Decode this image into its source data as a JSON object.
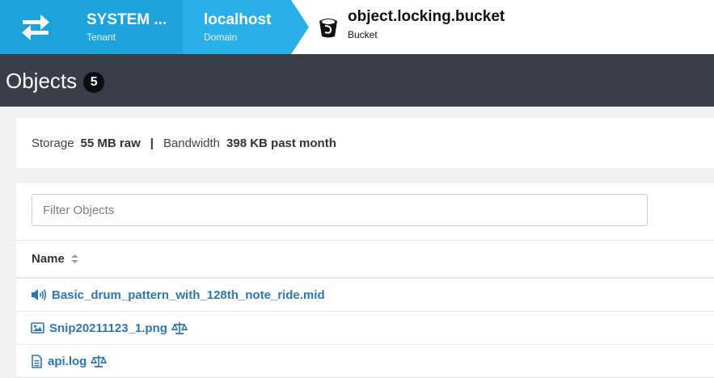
{
  "breadcrumb": {
    "tenant": {
      "title": "SYSTEM ...",
      "subtitle": "Tenant"
    },
    "domain": {
      "title": "localhost",
      "subtitle": "Domain"
    },
    "bucket": {
      "title": "object.locking.bucket",
      "subtitle": "Bucket"
    }
  },
  "page": {
    "title": "Objects",
    "count": "5"
  },
  "stats": {
    "storage_label": "Storage",
    "storage_value": "55 MB raw",
    "separator": "|",
    "bandwidth_label": "Bandwidth",
    "bandwidth_value": "398 KB past month"
  },
  "filter": {
    "placeholder": "Filter Objects",
    "value": ""
  },
  "table": {
    "column_name": "Name",
    "rows": [
      {
        "name": "Basic_drum_pattern_with_128th_note_ride.mid",
        "icon": "audio-icon",
        "legal_hold": false
      },
      {
        "name": "Snip20211123_1.png",
        "icon": "image-icon",
        "legal_hold": true
      },
      {
        "name": "api.log",
        "icon": "document-icon",
        "legal_hold": true
      }
    ]
  },
  "colors": {
    "breadcrumb_primary": "#1da3dc",
    "breadcrumb_secondary": "#29b0e8",
    "title_bar": "#393e49",
    "link": "#2a78b6"
  }
}
